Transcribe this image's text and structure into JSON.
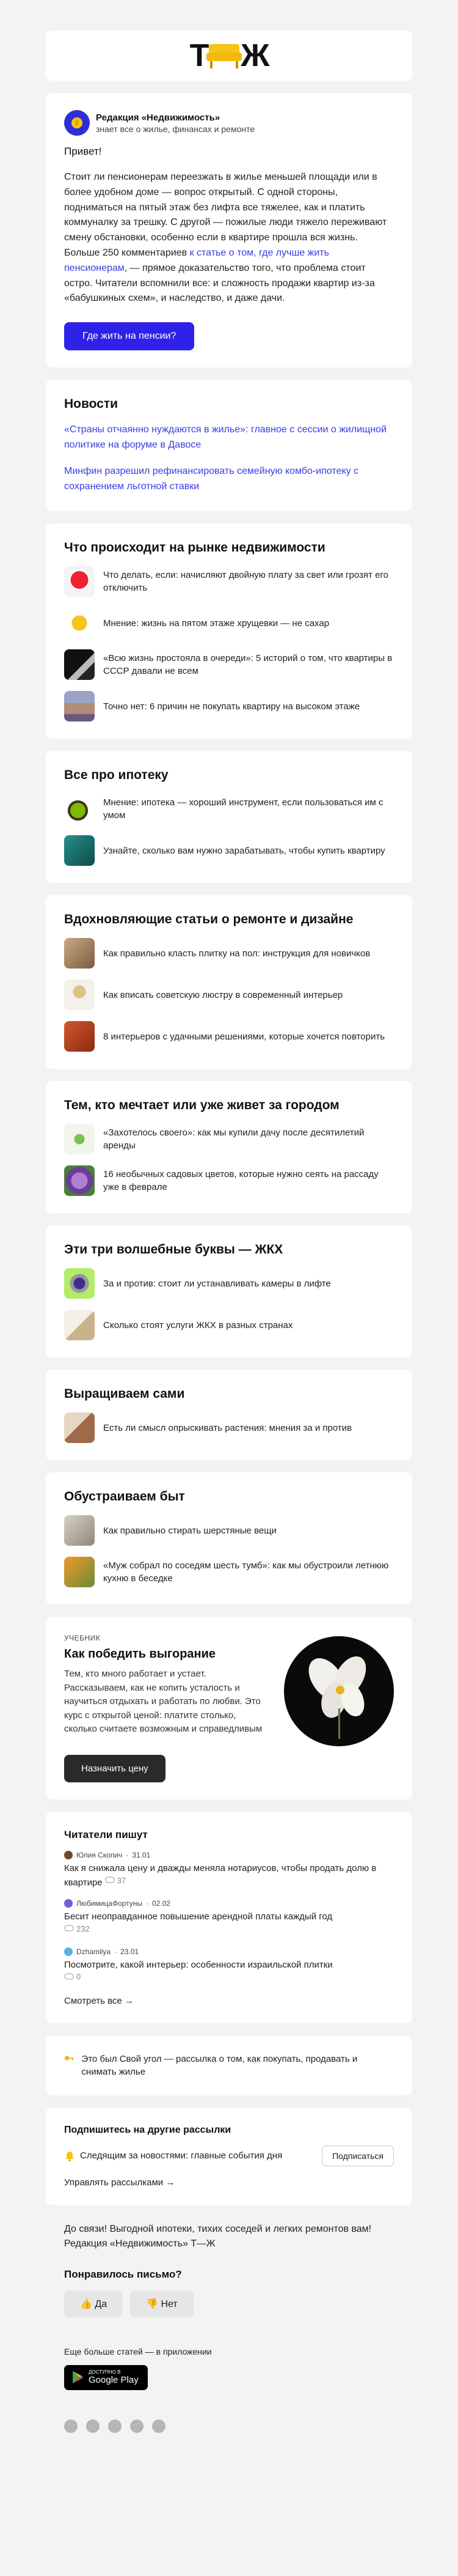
{
  "logo": {
    "text_left": "Т",
    "text_right": "Ж"
  },
  "author": {
    "name": "Редакция «Недвижимость»",
    "subtitle": "знает все о жилье, финансах и ремонте"
  },
  "greeting": "Привет!",
  "lead": {
    "text_before": "Стоит ли пенсионерам переезжать в жилье меньшей площади или в более удобном доме — вопрос открытый. С одной стороны, подниматься на пятый этаж без лифта все тяжелее, как и платить коммуналку за трешку. С другой — пожилые люди тяжело переживают смену обстановки, особенно если в квартире прошла вся жизнь. Больше 250 комментариев ",
    "link": "к статье о том, где лучше жить пенсионерам",
    "text_after": ", — прямое доказательство того, что проблема стоит остро. Читатели вспомнили все: и сложность продажи квартир из-за «бабушкиных схем», и наследство, и даже дачи."
  },
  "cta_button": "Где жить на пенсии?",
  "news": {
    "title": "Новости",
    "items": [
      "«Страны отчаянно нуждаются в жилье»: главное с сессии о жилищной политике на форуме в Давосе",
      "Минфин разрешил рефинансировать семейную комбо-ипотеку с сохранением льготной ставки"
    ]
  },
  "sections": [
    {
      "title": "Что происходит на рынке недвижимости",
      "items": [
        "Что делать, если: начисляют двойную плату за свет или грозят его отключить",
        "Мнение: жизнь на пятом этаже хрущевки — не сахар",
        "«Всю жизнь простояла в очереди»: 5 историй о том, что квартиры в СССР давали не всем",
        "Точно нет: 6 причин не покупать квартиру на высоком этаже"
      ]
    },
    {
      "title": "Все про ипотеку",
      "items": [
        "Мнение: ипотека — хороший инструмент, если пользоваться им с умом",
        "Узнайте, сколько вам нужно зарабатывать, чтобы купить квартиру"
      ]
    },
    {
      "title": "Вдохновляющие статьи о ремонте и дизайне",
      "items": [
        "Как правильно класть плитку на пол: инструкция для новичков",
        "Как вписать советскую люстру в современный интерьер",
        "8 интерьеров с удачными решениями, которые хочется повторить"
      ]
    },
    {
      "title": "Тем, кто мечтает или уже живет за городом",
      "items": [
        "«Захотелось своего»: как мы купили дачу после десятилетий аренды",
        "16 необычных садовых цветов, которые нужно сеять на рассаду уже в феврале"
      ]
    },
    {
      "title": "Эти три волшебные буквы — ЖКХ",
      "items": [
        "За и против: стоит ли устанавливать камеры в лифте",
        "Сколько стоят услуги ЖКХ в разных странах"
      ]
    },
    {
      "title": "Выращиваем сами",
      "items": [
        "Есть ли смысл опрыскивать растения: мнения за и против"
      ]
    },
    {
      "title": "Обустраиваем быт",
      "items": [
        "Как правильно стирать шерстяные вещи",
        "«Муж собрал по соседям шесть тумб»: как мы обустроили летнюю кухню в беседке"
      ]
    }
  ],
  "promo": {
    "kicker": "УЧЕБНИК",
    "title": "Как победить выгорание",
    "text": "Тем, кто много работает и устает. Рассказываем, как не копить усталость и научиться отдыхать и работать по любви. Это курс с открытой ценой: платите столько, сколько считаете возможным и справедливым",
    "button": "Назначить цену"
  },
  "readers": {
    "title": "Читатели пишут",
    "items": [
      {
        "author": "Юлия Скопич",
        "date": "31.01",
        "title": "Как я снижала цену и дважды меняла нотариусов, чтобы продать долю в квартире",
        "comments": "37"
      },
      {
        "author": "ЛюбимицаФортуны",
        "date": "02.02",
        "title": "Бесит неоправданное повышение арендной платы каждый год",
        "comments": "232"
      },
      {
        "author": "Dzhamilya",
        "date": "23.01",
        "title": "Посмотрите, какой интерьер: особенности израильской плитки",
        "comments": "0"
      }
    ],
    "see_all": "Смотреть все  →"
  },
  "corner": {
    "text": "Это был Свой угол — рассылка о том, как покупать, продавать и снимать жилье"
  },
  "subscribe": {
    "title": "Подпишитесь на другие рассылки",
    "item": "Следящим за новостями: главные события дня",
    "button": "Подписаться",
    "manage": "Управлять рассылками  →"
  },
  "farewell": "До связи! Выгодной ипотеки, тихих соседей и легких ремонтов вам! Редакция «Недвижимость» Т—Ж",
  "vote": {
    "title": "Понравилось письмо?",
    "yes": "Да",
    "no": "Нет"
  },
  "footer": {
    "app_text": "Еще больше статей — в приложении",
    "gp_small": "ДОСТУПНО В",
    "gp_big": "Google Play"
  },
  "icons": [
    "hand-icon",
    "thumbs-up-icon",
    "thumbs-down-icon",
    "key-icon",
    "bell-icon",
    "comment-icon",
    "telegram-icon",
    "vk-icon",
    "tj-icon",
    "x-icon",
    "youtube-icon"
  ],
  "colors": {
    "accent": "#2e22e8",
    "link": "#3a3ae8",
    "dark_button": "#2a2a2a",
    "logo_yellow": "#f5c518"
  }
}
